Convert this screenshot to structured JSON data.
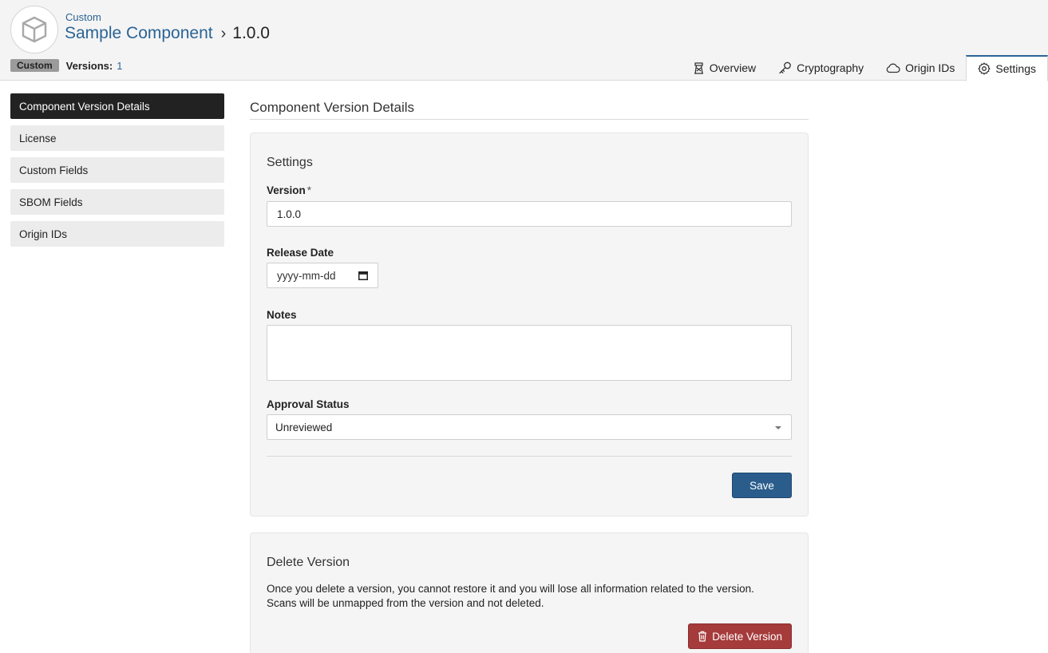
{
  "header": {
    "breadcrumb_parent": "Custom",
    "component_name": "Sample Component",
    "version_title": "1.0.0",
    "badge": "Custom",
    "versions_label": "Versions:",
    "versions_count": "1",
    "logo_icon": "cube-icon"
  },
  "tabs": [
    {
      "label": "Overview",
      "icon": "tower-icon",
      "active": false
    },
    {
      "label": "Cryptography",
      "icon": "key-icon",
      "active": false
    },
    {
      "label": "Origin IDs",
      "icon": "cloud-icon",
      "active": false
    },
    {
      "label": "Settings",
      "icon": "gear-icon",
      "active": true
    }
  ],
  "sidebar": {
    "items": [
      {
        "label": "Component Version Details",
        "active": true
      },
      {
        "label": "License",
        "active": false
      },
      {
        "label": "Custom Fields",
        "active": false
      },
      {
        "label": "SBOM Fields",
        "active": false
      },
      {
        "label": "Origin IDs",
        "active": false
      }
    ]
  },
  "main": {
    "section_title": "Component Version Details",
    "settings": {
      "title": "Settings",
      "version_label": "Version",
      "required_mark": "*",
      "version_value": "1.0.0",
      "release_date_label": "Release Date",
      "release_date_placeholder": "yyyy-mm-dd",
      "notes_label": "Notes",
      "notes_value": "",
      "approval_label": "Approval Status",
      "approval_value": "Unreviewed",
      "save_label": "Save"
    },
    "delete": {
      "title": "Delete Version",
      "line1": "Once you delete a version, you cannot restore it and you will lose all information related to the version.",
      "line2": "Scans will be unmapped from the version and not deleted.",
      "button_label": "Delete Version"
    }
  },
  "colors": {
    "accent": "#2b6495",
    "save_button": "#2a5d8c",
    "delete_button": "#a63b3b",
    "sidebar_active": "#222222"
  }
}
